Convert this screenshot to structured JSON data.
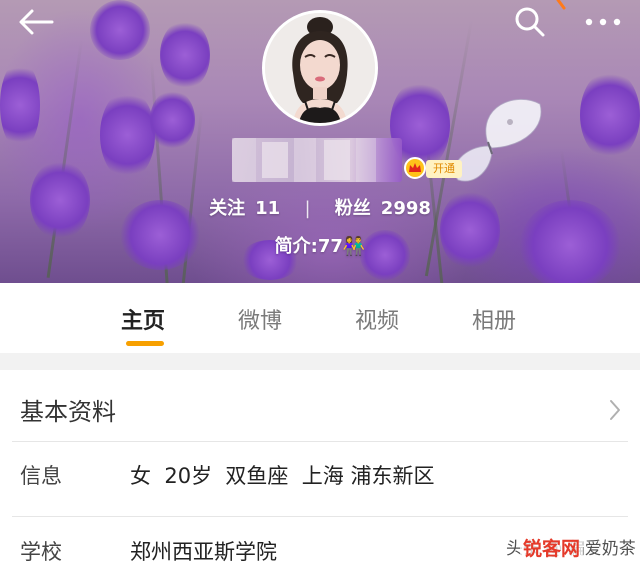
{
  "header": {
    "back_icon": "back-arrow-icon",
    "search_icon": "search-icon",
    "more_icon": "more-dots-icon"
  },
  "profile": {
    "open_badge": "开通",
    "following_label": "关注",
    "following_count": "11",
    "separator": "|",
    "followers_label": "粉丝",
    "followers_count": "2998",
    "bio": "简介:77👫"
  },
  "tabs": [
    {
      "label": "主页",
      "active": true
    },
    {
      "label": "微博",
      "active": false
    },
    {
      "label": "视频",
      "active": false
    },
    {
      "label": "相册",
      "active": false
    }
  ],
  "info": {
    "section_title": "基本资料",
    "rows": [
      {
        "label": "信息",
        "value": "女  20岁  双鱼座  上海 浦东新区"
      },
      {
        "label": "学校",
        "value": "郑州西亚斯学院"
      }
    ]
  },
  "watermark": {
    "text": "头条 @ 偏爱奶茶",
    "logo": "锐客网"
  },
  "colors": {
    "accent": "#f7a000",
    "vip": "#ffc21a"
  }
}
